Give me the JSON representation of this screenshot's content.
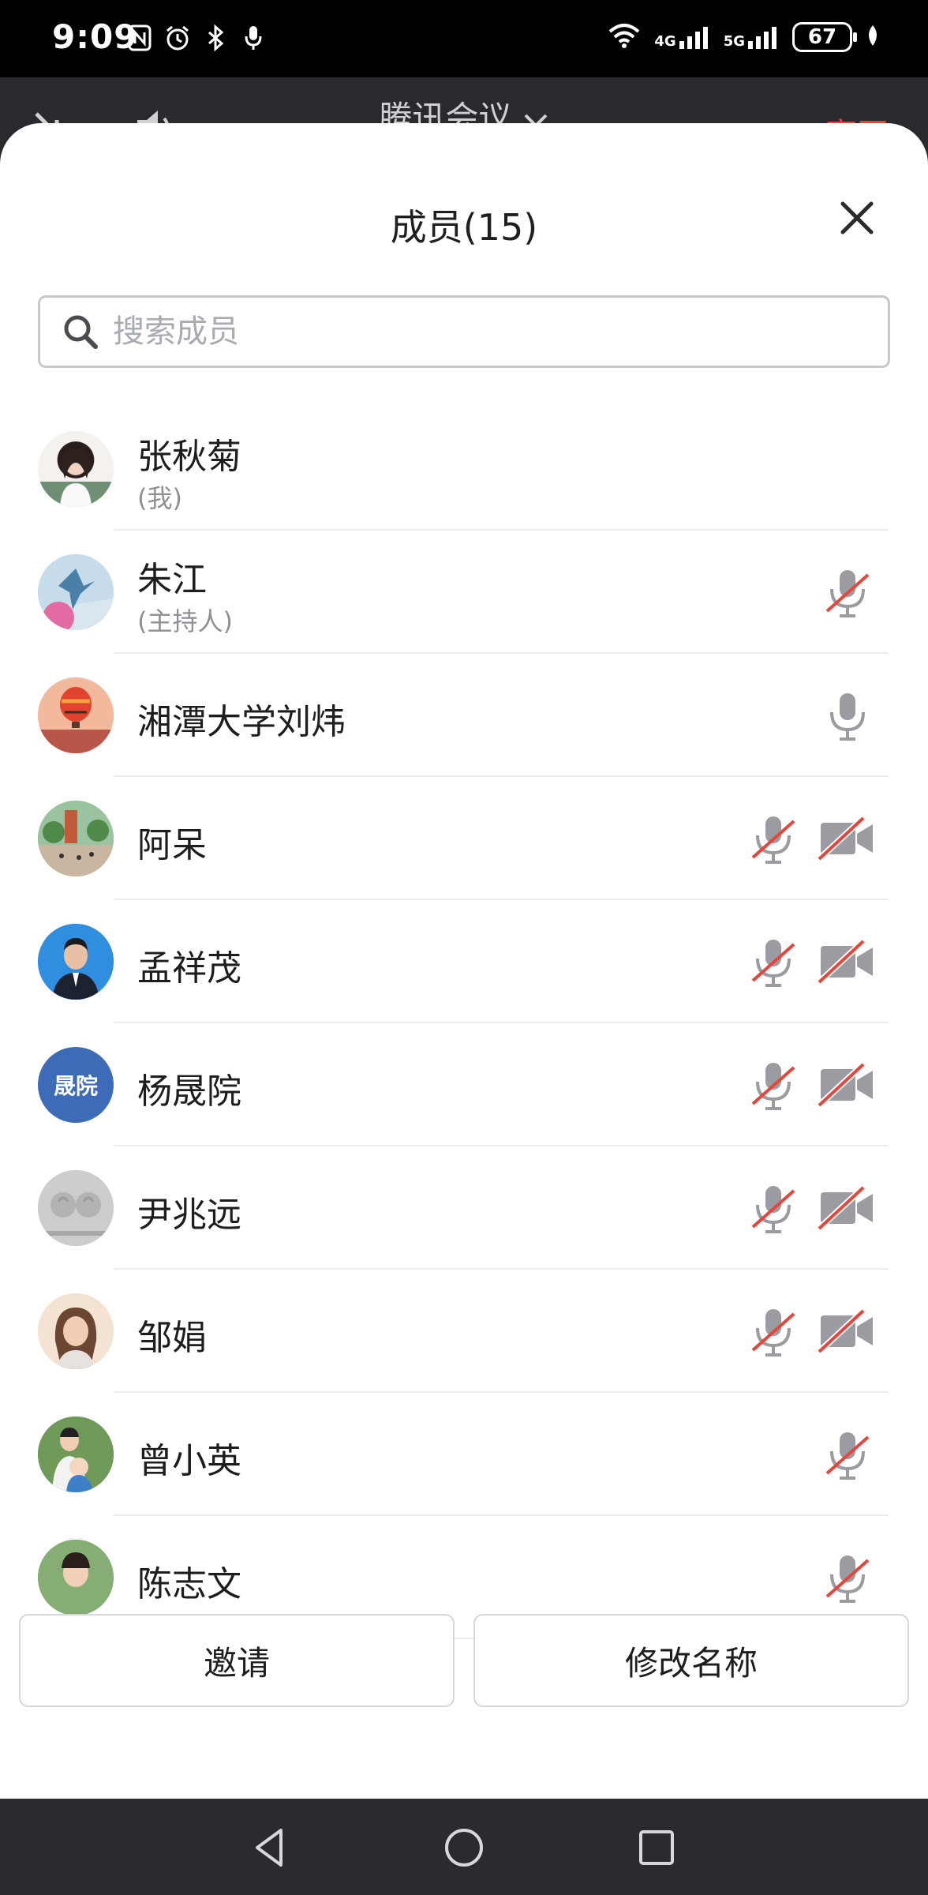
{
  "status_bar": {
    "time": "9:09",
    "net1": "4G",
    "net2": "5G",
    "battery": "67"
  },
  "meeting": {
    "title": "腾讯会议",
    "leave_label": "离开"
  },
  "sheet": {
    "title": "成员(15)",
    "search_placeholder": "搜索成员"
  },
  "members": [
    {
      "name": "张秋菊",
      "role": "(我)",
      "avatar": "photo",
      "mic": "none",
      "camera": "none"
    },
    {
      "name": "朱江",
      "role": "(主持人)",
      "avatar": "photo",
      "mic": "muted",
      "camera": "none"
    },
    {
      "name": "湘潭大学刘炜",
      "role": "",
      "avatar": "balloon",
      "mic": "on",
      "camera": "none"
    },
    {
      "name": "阿呆",
      "role": "",
      "avatar": "photo",
      "mic": "muted",
      "camera": "off"
    },
    {
      "name": "孟祥茂",
      "role": "",
      "avatar": "photo",
      "mic": "muted",
      "camera": "off"
    },
    {
      "name": "杨晟院",
      "role": "",
      "avatar": "text",
      "avatar_text": "晟院",
      "mic": "muted",
      "camera": "off"
    },
    {
      "name": "尹兆远",
      "role": "",
      "avatar": "photo",
      "mic": "muted",
      "camera": "off"
    },
    {
      "name": "邹娟",
      "role": "",
      "avatar": "photo",
      "mic": "muted",
      "camera": "off"
    },
    {
      "name": "曾小英",
      "role": "",
      "avatar": "photo",
      "mic": "muted",
      "camera": "none"
    },
    {
      "name": "陈志文",
      "role": "",
      "avatar": "photo",
      "mic": "muted",
      "camera": "none"
    }
  ],
  "footer": {
    "invite_label": "邀请",
    "rename_label": "修改名称"
  },
  "colors": {
    "accent_red": "#e5453a",
    "icon_gray": "#9a9ca2",
    "avatar_blue": "#3d6bb8"
  }
}
